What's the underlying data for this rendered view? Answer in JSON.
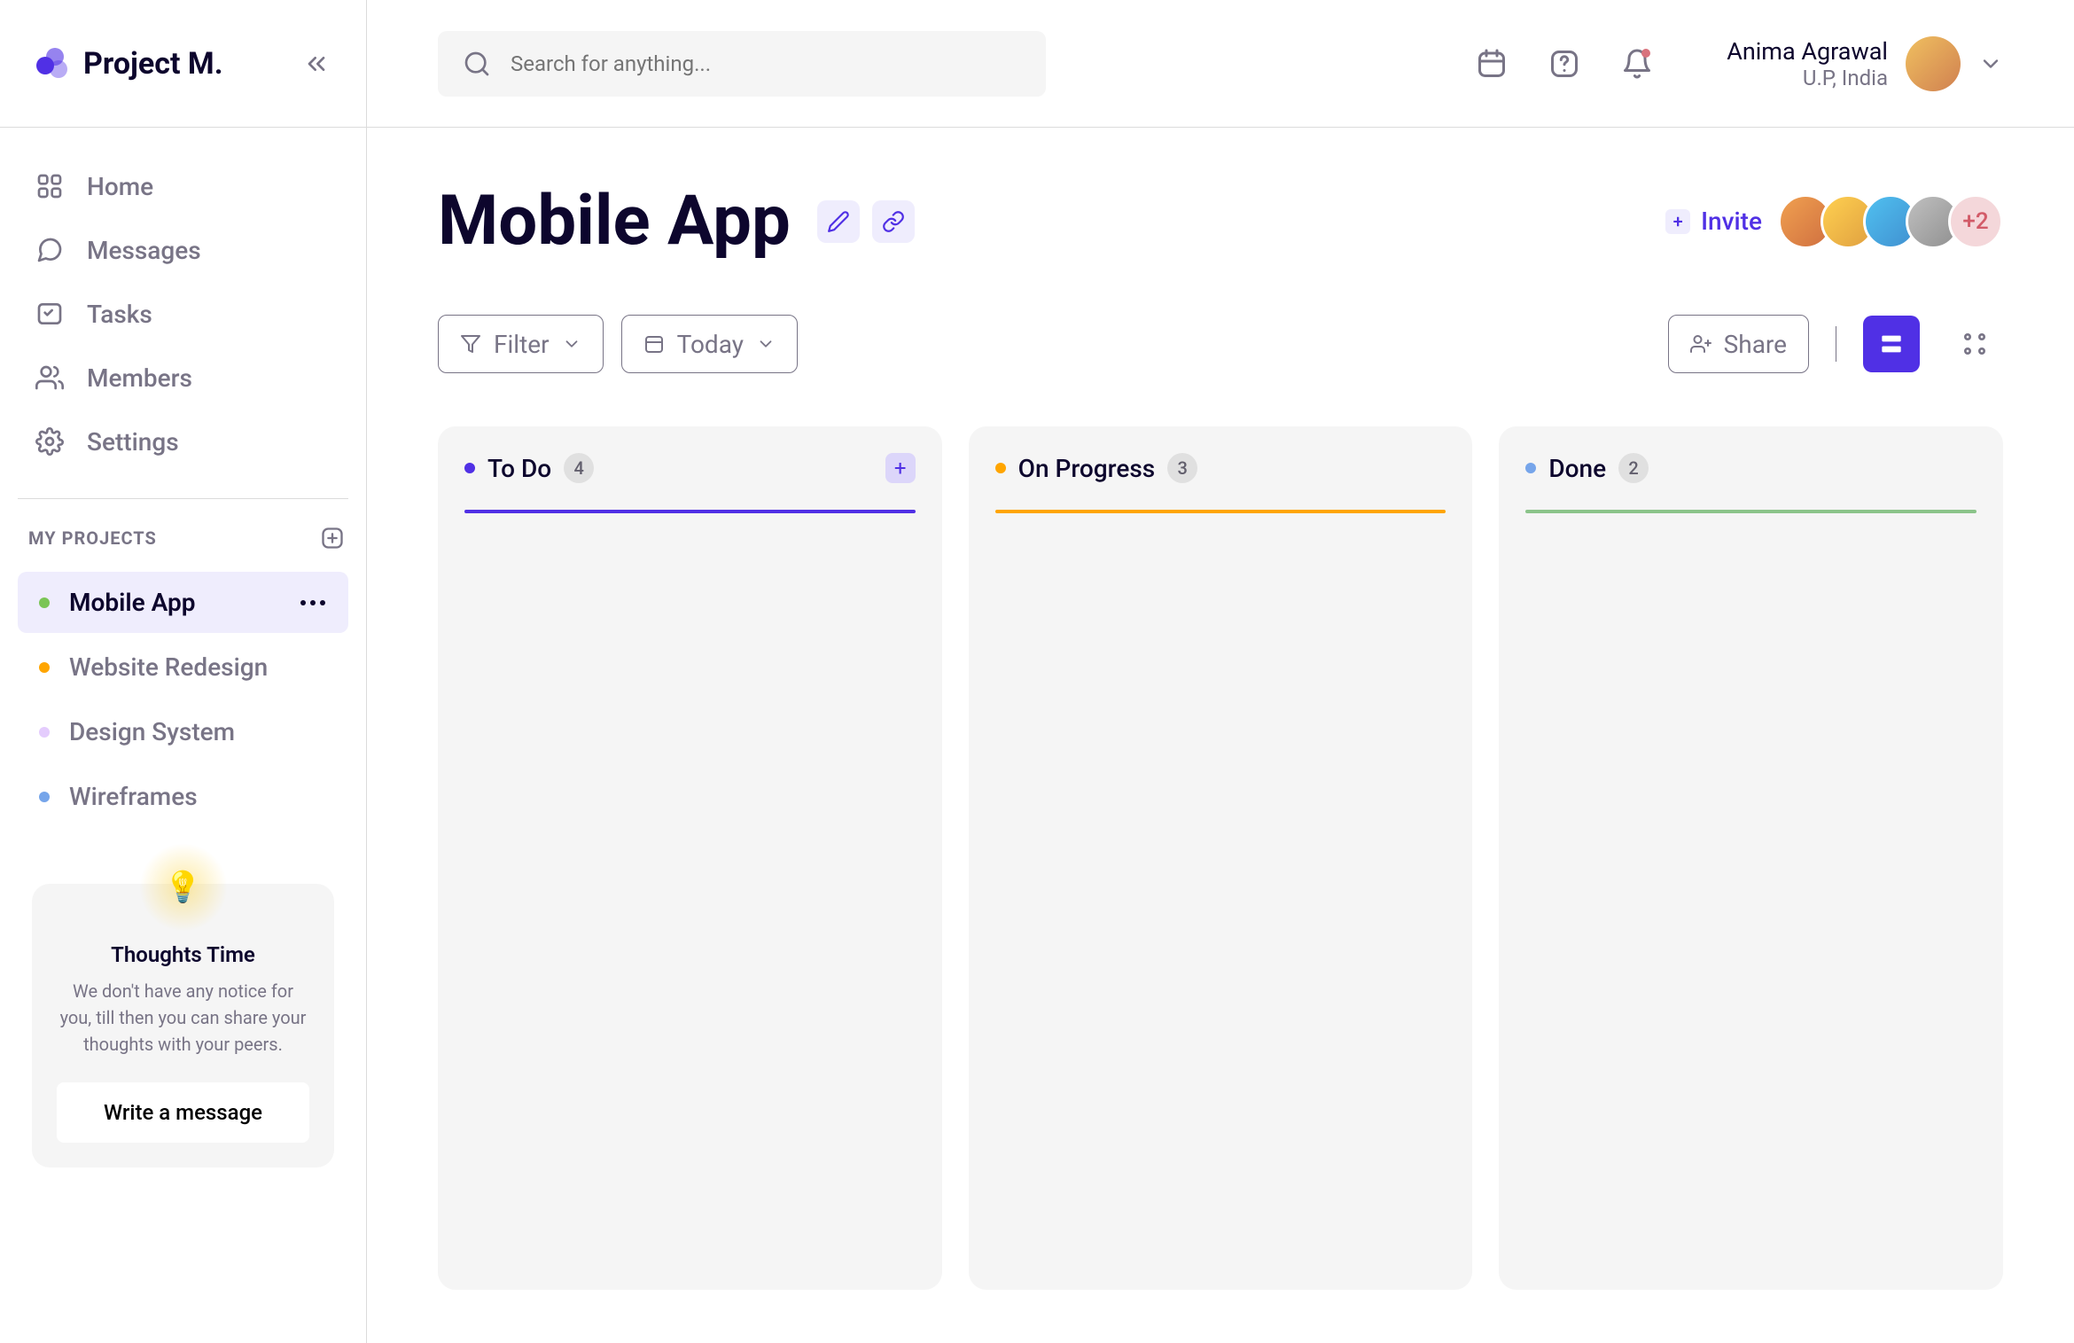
{
  "app": {
    "name": "Project M."
  },
  "search": {
    "placeholder": "Search for anything..."
  },
  "user": {
    "name": "Anima Agrawal",
    "location": "U.P, India"
  },
  "nav": [
    {
      "label": "Home"
    },
    {
      "label": "Messages"
    },
    {
      "label": "Tasks"
    },
    {
      "label": "Members"
    },
    {
      "label": "Settings"
    }
  ],
  "projects_header": "MY PROJECTS",
  "projects": [
    {
      "label": "Mobile App",
      "color": "#7ac555",
      "active": true
    },
    {
      "label": "Website Redesign",
      "color": "#ffa500",
      "active": false
    },
    {
      "label": "Design System",
      "color": "#e4ccfd",
      "active": false
    },
    {
      "label": "Wireframes",
      "color": "#76a5ea",
      "active": false
    }
  ],
  "thoughts": {
    "title": "Thoughts Time",
    "body": "We don't have any notice for you, till then you can share your thoughts with your peers.",
    "cta": "Write a message"
  },
  "page": {
    "title": "Mobile App"
  },
  "invite": {
    "label": "Invite",
    "extra": "+2"
  },
  "controls": {
    "filter": "Filter",
    "today": "Today",
    "share": "Share"
  },
  "columns": [
    {
      "title": "To Do",
      "count": "4",
      "color": "#5030e5",
      "add": true
    },
    {
      "title": "On Progress",
      "count": "3",
      "color": "#ffa500",
      "add": false
    },
    {
      "title": "Done",
      "count": "2",
      "color": "#8bc48a",
      "dot_color": "#76a5ea",
      "add": false
    }
  ]
}
